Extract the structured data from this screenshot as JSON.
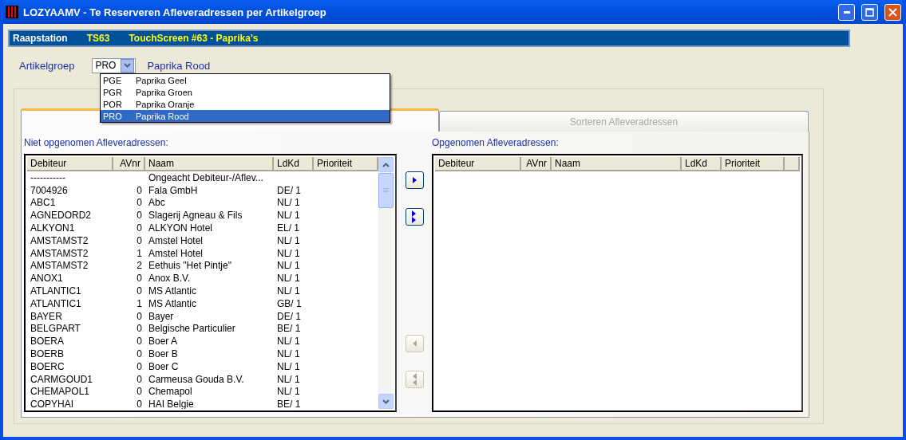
{
  "window": {
    "title": "LOZYAAMV - Te Reserveren Afleveradressen per Artikelgroep"
  },
  "info_bar": {
    "label": "Raapstation",
    "code": "TS63",
    "name": "TouchScreen #63 - Paprika's"
  },
  "artikelgroep": {
    "label": "Artikelgroep",
    "value": "PRO",
    "description": "Paprika Rood",
    "expanded": true,
    "options": [
      {
        "code": "PGE",
        "name": "Paprika Geel",
        "selected": false
      },
      {
        "code": "PGR",
        "name": "Paprika Groen",
        "selected": false
      },
      {
        "code": "POR",
        "name": "Paprika Oranje",
        "selected": false
      },
      {
        "code": "PRO",
        "name": "Paprika Rood",
        "selected": true
      }
    ]
  },
  "tabs": [
    {
      "selected": true
    },
    {
      "label": "Sorteren Afleveradressen",
      "selected": false
    }
  ],
  "left_list": {
    "title": "Niet opgenomen Afleveradressen:",
    "columns": [
      "Debiteur",
      "AVnr",
      "Naam",
      "LdKd",
      "Prioriteit"
    ],
    "rows": [
      [
        "-----------",
        "",
        "Ongeacht Debiteur-/Aflev...",
        "",
        ""
      ],
      [
        "7004926",
        "0",
        "Fala GmbH",
        "DE/ 1",
        ""
      ],
      [
        "ABC1",
        "0",
        "Abc",
        "NL/ 1",
        ""
      ],
      [
        "AGNEDORD2",
        "0",
        "Slagerij Agneau & Fils",
        "NL/ 1",
        ""
      ],
      [
        "ALKYON1",
        "0",
        "ALKYON Hotel",
        "EL/ 1",
        ""
      ],
      [
        "AMSTAMST2",
        "0",
        "Amstel Hotel",
        "NL/ 1",
        ""
      ],
      [
        "AMSTAMST2",
        "1",
        "Amstel Hotel",
        "NL/ 1",
        ""
      ],
      [
        "AMSTAMST2",
        "2",
        "Eethuis \"Het Pintje\"",
        "NL/ 1",
        ""
      ],
      [
        "ANOX1",
        "0",
        "Anox B.V.",
        "NL/ 1",
        ""
      ],
      [
        "ATLANTIC1",
        "0",
        "MS Atlantic",
        "NL/ 1",
        ""
      ],
      [
        "ATLANTIC1",
        "1",
        "MS Atlantic",
        "GB/ 1",
        ""
      ],
      [
        "BAYER",
        "0",
        "Bayer",
        "DE/ 1",
        ""
      ],
      [
        "BELGPART",
        "0",
        "Belgische Particulier",
        "BE/ 1",
        ""
      ],
      [
        "BOERA",
        "0",
        "Boer A",
        "NL/ 1",
        ""
      ],
      [
        "BOERB",
        "0",
        "Boer B",
        "NL/ 1",
        ""
      ],
      [
        "BOERC",
        "0",
        "Boer C",
        "NL/ 1",
        ""
      ],
      [
        "CARMGOUD1",
        "0",
        "Carmeusa Gouda B.V.",
        "NL/ 1",
        ""
      ],
      [
        "CHEMAPOL1",
        "0",
        "Chemapol",
        "NL/ 1",
        ""
      ],
      [
        "COPYHAI",
        "0",
        "HAI Belgie",
        "BE/ 1",
        ""
      ]
    ]
  },
  "transfer_buttons": [
    {
      "kind": "add",
      "disabled": false
    },
    {
      "kind": "add_all",
      "disabled": false
    },
    {
      "kind": "remove",
      "disabled": true
    },
    {
      "kind": "remove_all",
      "disabled": true
    }
  ],
  "right_list": {
    "title": "Opgenomen Afleveradressen:",
    "columns": [
      "Debiteur",
      "AVnr",
      "Naam",
      "LdKd",
      "Prioriteit"
    ]
  }
}
